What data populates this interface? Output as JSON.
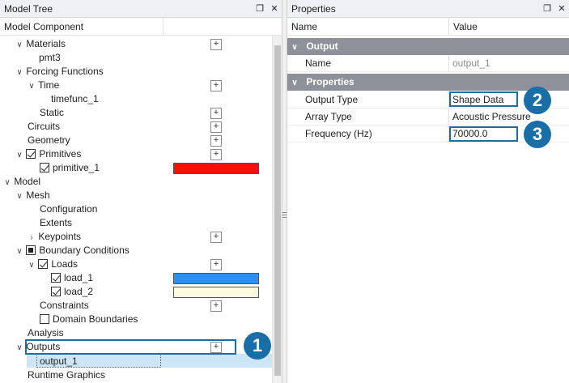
{
  "model_tree": {
    "title": "Model Tree",
    "column_header": "Model Component",
    "nodes": {
      "materials": "Materials",
      "pmt3": "pmt3",
      "forcing_functions": "Forcing Functions",
      "time": "Time",
      "timefunc_1": "timefunc_1",
      "static": "Static",
      "circuits": "Circuits",
      "geometry": "Geometry",
      "primitives": "Primitives",
      "primitive_1": "primitive_1",
      "model": "Model",
      "mesh": "Mesh",
      "configuration": "Configuration",
      "extents": "Extents",
      "keypoints": "Keypoints",
      "boundary_conditions": "Boundary Conditions",
      "loads": "Loads",
      "load_1": "load_1",
      "load_2": "load_2",
      "constraints": "Constraints",
      "domain_boundaries": "Domain Boundaries",
      "analysis": "Analysis",
      "outputs": "Outputs",
      "output_1": "output_1",
      "runtime_graphics": "Runtime Graphics"
    },
    "colors": {
      "primitive_1": "#ee1111",
      "load_1": "#2f8ff0",
      "load_2": "#fffbe0"
    }
  },
  "properties": {
    "title": "Properties",
    "col_name": "Name",
    "col_value": "Value",
    "section_output": "Output",
    "name_label": "Name",
    "name_value": "output_1",
    "section_properties": "Properties",
    "output_type_label": "Output Type",
    "output_type_value": "Shape Data",
    "array_type_label": "Array Type",
    "array_type_value": "Acoustic Pressure",
    "frequency_label": "Frequency (Hz)",
    "frequency_value": "70000.0"
  },
  "icons": {
    "pin": "pin-icon",
    "close": "close-icon",
    "expand": "chevron-down-icon",
    "collapsed": "chevron-right-icon",
    "add": "plus-icon"
  },
  "callouts": [
    "1",
    "2",
    "3"
  ],
  "accent_color": "#1a6ea8",
  "section_color": "#8e9199"
}
